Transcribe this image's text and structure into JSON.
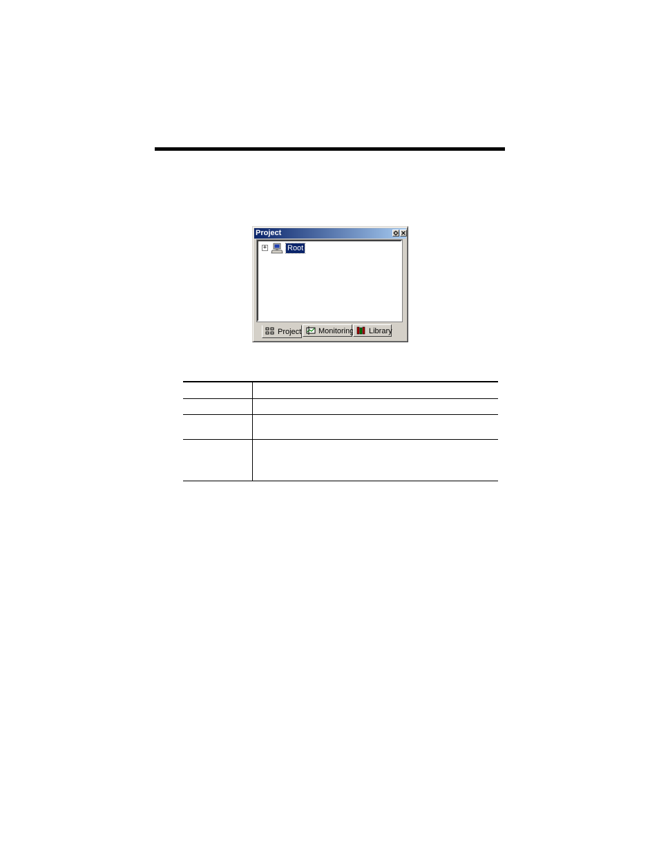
{
  "window": {
    "title": "Project",
    "tree_root_label": "Root",
    "expander_glyph": "+",
    "tabs": [
      {
        "label": "Project",
        "icon": "project-tree-icon",
        "active": true
      },
      {
        "label": "Monitoring",
        "icon": "monitoring-icon",
        "active": false
      },
      {
        "label": "Library",
        "icon": "library-books-icon",
        "active": false
      }
    ]
  },
  "colors": {
    "titlebar_start": "#0a246a",
    "titlebar_end": "#a6caf0",
    "selection": "#0a246a",
    "face": "#d4d0c8"
  }
}
